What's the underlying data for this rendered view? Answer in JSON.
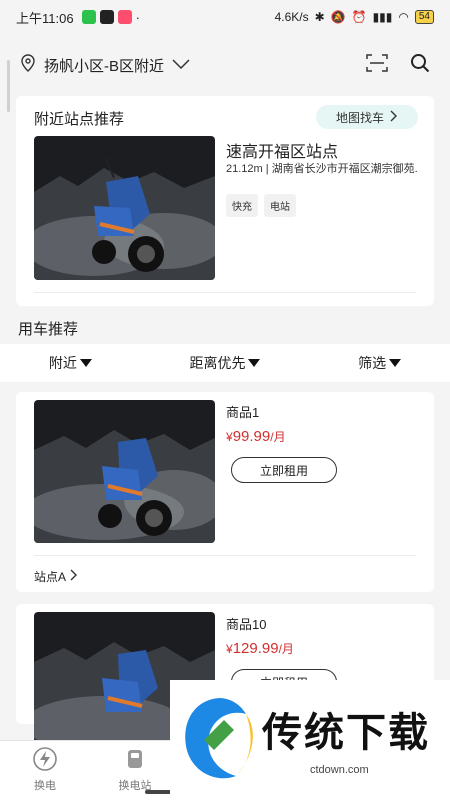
{
  "status_bar": {
    "time": "上午11:06",
    "dot": "·",
    "network_speed": "4.6K/s",
    "battery": "54",
    "icons": [
      "wechat-icon",
      "douyin-icon",
      "app-icon",
      "bluetooth-icon",
      "mute-icon",
      "alarm-icon",
      "signal-icon",
      "wifi-icon",
      "battery-icon"
    ]
  },
  "location": {
    "text": "扬帆小区-B区附近",
    "icons": [
      "location-pin-icon",
      "chevron-down-icon",
      "scan-icon",
      "search-icon"
    ]
  },
  "nearby": {
    "title": "附近站点推荐",
    "map_button": "地图找车",
    "station": {
      "name": "速高开福区站点",
      "distance": "21.12m",
      "separator": "|",
      "address": "湖南省长沙市开福区潮宗御苑.",
      "tags": [
        "快充",
        "电站"
      ]
    }
  },
  "section_title": "用车推荐",
  "filters": [
    {
      "label": "附近"
    },
    {
      "label": "距离优先"
    },
    {
      "label": "筛选"
    }
  ],
  "products": [
    {
      "name": "商品1",
      "currency": "¥",
      "price": "99.99",
      "unit": "/月",
      "button": "立即租用",
      "station": "站点A"
    },
    {
      "name": "商品10",
      "currency": "¥",
      "price": "129.99",
      "unit": "/月",
      "button": "立即租用"
    }
  ],
  "bottom_nav": [
    {
      "label": "换电",
      "icon": "battery-swap-icon"
    },
    {
      "label": "换电站",
      "icon": "station-icon"
    }
  ],
  "watermark": {
    "text": "传统下载",
    "domain": "ctdown.com"
  },
  "colors": {
    "price": "#d32f2f",
    "map_button_bg": "#e6f6f5",
    "page_bg": "#f4f4f4"
  }
}
